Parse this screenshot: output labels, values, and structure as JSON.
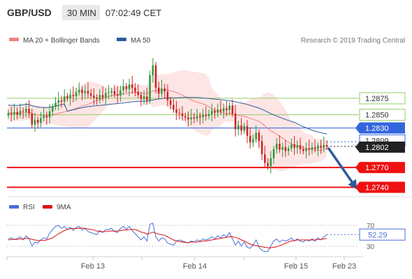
{
  "header": {
    "pair": "GBP/USD",
    "timeframe": "30 MIN",
    "time": "07:02:49 CET"
  },
  "legend": {
    "ma20_bb": "MA 20 + Bollinger Bands",
    "ma50": "MA 50",
    "ma20_color": "#f08080",
    "ma50_color": "#2e5c9a"
  },
  "credit": "Research © 2019 Trading Central",
  "rsi_legend": {
    "rsi": "RSI",
    "ma9": "9MA",
    "rsi_color": "#4a6fd8",
    "ma9_color": "#dd1111"
  },
  "colors": {
    "up_candle": "#2a9a3a",
    "down_candle": "#cc2222",
    "bb_fill": "#fde0e0",
    "resistance_line": "#99cc66",
    "pivot_line": "#3366dd",
    "support_line": "#ee1111",
    "current_price_bg": "#222222",
    "arrow": "#2e5c9a"
  },
  "chart_data": {
    "type": "candlestick",
    "x_labels": [
      "Feb 13",
      "Feb 14",
      "Feb 15",
      "Feb 23"
    ],
    "levels": [
      {
        "value": "1.2875",
        "kind": "resistance"
      },
      {
        "value": "1.2850",
        "kind": "resistance"
      },
      {
        "value": "1.2830",
        "kind": "pivot"
      },
      {
        "value": "1.2809",
        "kind": "reference"
      },
      {
        "value": "1.2802",
        "kind": "current"
      },
      {
        "value": "1.2770",
        "kind": "support"
      },
      {
        "value": "1.2740",
        "kind": "support"
      }
    ],
    "closes": [
      1.2853,
      1.2851,
      1.2854,
      1.285,
      1.2856,
      1.2855,
      1.2859,
      1.2852,
      1.2835,
      1.2842,
      1.2838,
      1.2845,
      1.2848,
      1.2846,
      1.2855,
      1.2862,
      1.2868,
      1.2872,
      1.287,
      1.2878,
      1.2875,
      1.288,
      1.2878,
      1.2884,
      1.2888,
      1.2883,
      1.2886,
      1.2882,
      1.2879,
      1.2876,
      1.2874,
      1.288,
      1.2876,
      1.2883,
      1.2884,
      1.2886,
      1.2881,
      1.2879,
      1.2887,
      1.2893,
      1.2889,
      1.2896,
      1.2891,
      1.2885,
      1.288,
      1.2874,
      1.2878,
      1.2872,
      1.291,
      1.2925,
      1.2891,
      1.2882,
      1.289,
      1.2885,
      1.2872,
      1.2865,
      1.2858,
      1.2853,
      1.2852,
      1.2848,
      1.2846,
      1.2843,
      1.2846,
      1.2844,
      1.2848,
      1.2846,
      1.285,
      1.2848,
      1.2851,
      1.2856,
      1.2853,
      1.2858,
      1.2855,
      1.286,
      1.2857,
      1.2864,
      1.2852,
      1.2828,
      1.2834,
      1.2826,
      1.2833,
      1.2818,
      1.2808,
      1.2813,
      1.2823,
      1.281,
      1.279,
      1.2777,
      1.2772,
      1.2784,
      1.2798,
      1.2806,
      1.2797,
      1.2801,
      1.2795,
      1.2799,
      1.2805,
      1.28,
      1.2804,
      1.2798,
      1.2795,
      1.2799,
      1.2797,
      1.2801,
      1.2798,
      1.2803,
      1.28,
      1.2804,
      1.2802
    ],
    "y_range": [
      1.273,
      1.295
    ],
    "forecast": {
      "from": "1.2802",
      "to": "1.2740"
    },
    "rsi": {
      "ticks": [
        70,
        30
      ],
      "current": "52.29",
      "values": [
        44,
        46,
        43,
        45,
        48,
        42,
        50,
        44,
        30,
        38,
        36,
        42,
        46,
        44,
        55,
        62,
        68,
        70,
        64,
        68,
        62,
        66,
        60,
        66,
        68,
        61,
        64,
        58,
        56,
        54,
        52,
        60,
        56,
        62,
        62,
        64,
        58,
        56,
        64,
        68,
        62,
        68,
        60,
        54,
        48,
        42,
        48,
        40,
        72,
        74,
        48,
        40,
        46,
        44,
        36,
        34,
        32,
        40,
        42,
        40,
        38,
        36,
        40,
        38,
        42,
        40,
        44,
        42,
        44,
        48,
        44,
        50,
        46,
        52,
        48,
        56,
        44,
        32,
        40,
        30,
        38,
        28,
        26,
        32,
        42,
        28,
        22,
        20,
        20,
        30,
        40,
        44,
        38,
        42,
        40,
        42,
        46,
        40,
        44,
        40,
        38,
        42,
        40,
        44,
        40,
        46,
        42,
        48,
        52
      ],
      "ma9": [
        42,
        43,
        43,
        43,
        44,
        44,
        45,
        45,
        43,
        42,
        41,
        41,
        41,
        42,
        44,
        46,
        50,
        54,
        57,
        60,
        62,
        64,
        64,
        64,
        64,
        65,
        64,
        63,
        62,
        61,
        59,
        58,
        58,
        58,
        59,
        59,
        59,
        59,
        60,
        61,
        61,
        62,
        62,
        62,
        60,
        57,
        56,
        53,
        55,
        57,
        55,
        53,
        52,
        51,
        48,
        45,
        42,
        40,
        39,
        38,
        37,
        37,
        38,
        38,
        38,
        39,
        40,
        40,
        41,
        42,
        43,
        44,
        45,
        46,
        47,
        48,
        48,
        47,
        45,
        42,
        40,
        37,
        34,
        32,
        31,
        30,
        29,
        28,
        27,
        27,
        28,
        29,
        31,
        33,
        36,
        38,
        40,
        41,
        42,
        42,
        42,
        42,
        42,
        42,
        42,
        43,
        43,
        44,
        45
      ]
    }
  }
}
